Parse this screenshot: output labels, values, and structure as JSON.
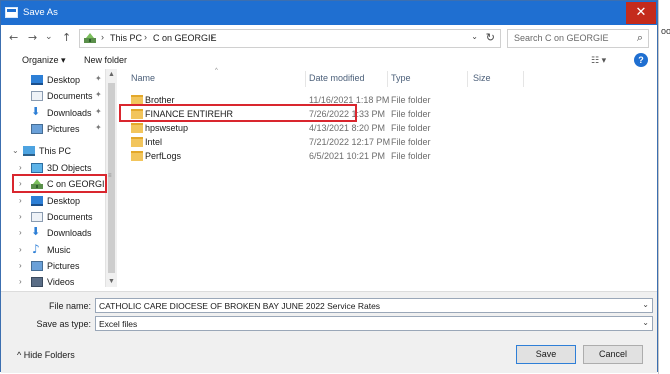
{
  "window": {
    "title": "Save As",
    "close_glyph": "✕",
    "app_icon": "save-as-window-icon"
  },
  "background": {
    "partial_text": "oo"
  },
  "navigation": {
    "back_glyph": "←",
    "forward_glyph": "→",
    "recent_glyph": "⌄",
    "up_glyph": "↑"
  },
  "address_bar": {
    "breadcrumbs": [
      "This PC",
      "C on GEORGIE"
    ],
    "separator_glyph": "›",
    "dropdown_glyph": "⌄",
    "refresh_glyph": "↻"
  },
  "search": {
    "placeholder": "Search C on GEORGIE",
    "icon_glyph": "⌕"
  },
  "toolbar": {
    "organize_label": "Organize ▾",
    "new_folder_label": "New folder",
    "view_glyph": "☷ ▾",
    "help_glyph": "?"
  },
  "sidebar": {
    "items": [
      {
        "label": "Desktop",
        "icon": "desktop-icon",
        "pinned": true
      },
      {
        "label": "Documents",
        "icon": "documents-icon",
        "pinned": true
      },
      {
        "label": "Downloads",
        "icon": "downloads-icon",
        "pinned": true
      },
      {
        "label": "Pictures",
        "icon": "pictures-icon",
        "pinned": true
      },
      {
        "label": "This PC",
        "icon": "this-pc-icon",
        "expanded": true
      },
      {
        "label": "3D Objects",
        "icon": "3d-objects-icon"
      },
      {
        "label": "C on GEORGIE",
        "icon": "network-drive-icon",
        "selected": true
      },
      {
        "label": "Desktop",
        "icon": "desktop-icon"
      },
      {
        "label": "Documents",
        "icon": "documents-icon"
      },
      {
        "label": "Downloads",
        "icon": "downloads-icon"
      },
      {
        "label": "Music",
        "icon": "music-icon"
      },
      {
        "label": "Pictures",
        "icon": "pictures-icon"
      },
      {
        "label": "Videos",
        "icon": "videos-icon"
      }
    ],
    "pin_glyph": "✦",
    "collapsed_glyph": "›",
    "expanded_glyph": "⌄"
  },
  "file_list": {
    "columns": [
      "Name",
      "Date modified",
      "Type",
      "Size"
    ],
    "sort_glyph": "^",
    "rows": [
      {
        "name": "Brother",
        "date": "11/16/2021 1:18 PM",
        "type": "File folder",
        "size": ""
      },
      {
        "name": "FINANCE ENTIREHR",
        "date": "7/26/2022 1:33 PM",
        "type": "File folder",
        "size": ""
      },
      {
        "name": "hpswsetup",
        "date": "4/13/2021 8:20 PM",
        "type": "File folder",
        "size": ""
      },
      {
        "name": "Intel",
        "date": "7/21/2022 12:17 PM",
        "type": "File folder",
        "size": ""
      },
      {
        "name": "PerfLogs",
        "date": "6/5/2021 10:21 PM",
        "type": "File folder",
        "size": ""
      }
    ]
  },
  "scrollbar": {
    "up_glyph": "▲",
    "down_glyph": "▼",
    "grip_glyph": "≡"
  },
  "form": {
    "file_name_label": "File name:",
    "file_name_value": "CATHOLIC CARE DIOCESE OF BROKEN BAY JUNE 2022 Service Rates",
    "save_as_type_label": "Save as type:",
    "save_as_type_value": "Excel files",
    "dropdown_glyph": "⌄"
  },
  "footer": {
    "hide_folders_label": "^  Hide Folders",
    "save_label": "Save",
    "cancel_label": "Cancel"
  },
  "highlight_color": "#d9262e",
  "accent_color": "#1f6fd1"
}
